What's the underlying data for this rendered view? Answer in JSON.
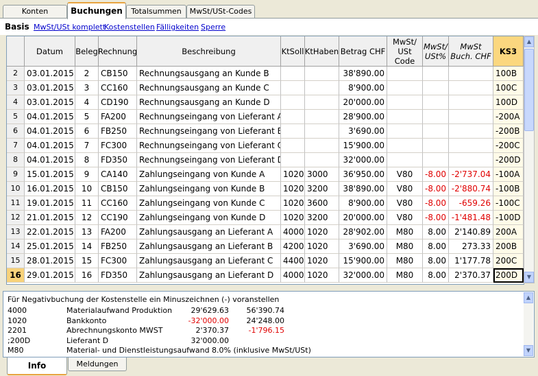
{
  "tabs": [
    "Konten",
    "Buchungen",
    "Totalsummen",
    "MwSt/USt-Codes"
  ],
  "views": [
    "Basis",
    "MwSt/USt komplett",
    "Kostenstellen",
    "Fälligkeiten",
    "Sperre"
  ],
  "columns": {
    "datum": "Datum",
    "beleg": "Beleg",
    "rechnung": "Rechnung",
    "beschreibung": "Beschreibung",
    "ktsoll": "KtSoll",
    "kthaben": "KtHaben",
    "betrag": "Betrag CHF",
    "mwst_code": "MwSt/ USt Code",
    "mwst_pct": "MwSt/ USt%",
    "mwst_buch": "MwSt Buch. CHF",
    "ks3": "KS3"
  },
  "rows": [
    {
      "n": "2",
      "datum": "03.01.2015",
      "beleg": "2",
      "rechnung": "CB150",
      "beschreibung": "Rechnungsausgang an Kunde B",
      "ktsoll": "",
      "kthaben": "",
      "betrag": "38'890.00",
      "code": "",
      "pct": "",
      "buch": "",
      "ks3": "100B"
    },
    {
      "n": "3",
      "datum": "03.01.2015",
      "beleg": "3",
      "rechnung": "CC160",
      "beschreibung": "Rechnungsausgang an Kunde C",
      "ktsoll": "",
      "kthaben": "",
      "betrag": "8'900.00",
      "code": "",
      "pct": "",
      "buch": "",
      "ks3": "100C"
    },
    {
      "n": "4",
      "datum": "03.01.2015",
      "beleg": "4",
      "rechnung": "CD190",
      "beschreibung": "Rechnungsausgang an Kunde D",
      "ktsoll": "",
      "kthaben": "",
      "betrag": "20'000.00",
      "code": "",
      "pct": "",
      "buch": "",
      "ks3": "100D"
    },
    {
      "n": "5",
      "datum": "04.01.2015",
      "beleg": "5",
      "rechnung": "FA200",
      "beschreibung": "Rechnungseingang von Lieferant A",
      "ktsoll": "",
      "kthaben": "",
      "betrag": "28'900.00",
      "code": "",
      "pct": "",
      "buch": "",
      "ks3": "-200A"
    },
    {
      "n": "6",
      "datum": "04.01.2015",
      "beleg": "6",
      "rechnung": "FB250",
      "beschreibung": "Rechnungseingang von Lieferant B",
      "ktsoll": "",
      "kthaben": "",
      "betrag": "3'690.00",
      "code": "",
      "pct": "",
      "buch": "",
      "ks3": "-200B"
    },
    {
      "n": "7",
      "datum": "04.01.2015",
      "beleg": "7",
      "rechnung": "FC300",
      "beschreibung": "Rechnungseingang von Lieferant C",
      "ktsoll": "",
      "kthaben": "",
      "betrag": "15'900.00",
      "code": "",
      "pct": "",
      "buch": "",
      "ks3": "-200C"
    },
    {
      "n": "8",
      "datum": "04.01.2015",
      "beleg": "8",
      "rechnung": "FD350",
      "beschreibung": "Rechnungseingang von Lieferant D",
      "ktsoll": "",
      "kthaben": "",
      "betrag": "32'000.00",
      "code": "",
      "pct": "",
      "buch": "",
      "ks3": "-200D"
    },
    {
      "n": "9",
      "datum": "15.01.2015",
      "beleg": "9",
      "rechnung": "CA140",
      "beschreibung": "Zahlungseingang von Kunde A",
      "ktsoll": "1020",
      "kthaben": "3000",
      "betrag": "36'950.00",
      "code": "V80",
      "pct": "-8.00",
      "buch": "-2'737.04",
      "ks3": "-100A"
    },
    {
      "n": "10",
      "datum": "16.01.2015",
      "beleg": "10",
      "rechnung": "CB150",
      "beschreibung": "Zahlungseingang von Kunde B",
      "ktsoll": "1020",
      "kthaben": "3200",
      "betrag": "38'890.00",
      "code": "V80",
      "pct": "-8.00",
      "buch": "-2'880.74",
      "ks3": "-100B"
    },
    {
      "n": "11",
      "datum": "19.01.2015",
      "beleg": "11",
      "rechnung": "CC160",
      "beschreibung": "Zahlungseingang von Kunde C",
      "ktsoll": "1020",
      "kthaben": "3600",
      "betrag": "8'900.00",
      "code": "V80",
      "pct": "-8.00",
      "buch": "-659.26",
      "ks3": "-100C"
    },
    {
      "n": "12",
      "datum": "21.01.2015",
      "beleg": "12",
      "rechnung": "CC190",
      "beschreibung": "Zahlungseingang von Kunde D",
      "ktsoll": "1020",
      "kthaben": "3200",
      "betrag": "20'000.00",
      "code": "V80",
      "pct": "-8.00",
      "buch": "-1'481.48",
      "ks3": "-100D"
    },
    {
      "n": "13",
      "datum": "22.01.2015",
      "beleg": "13",
      "rechnung": "FA200",
      "beschreibung": "Zahlungsausgang an Lieferant A",
      "ktsoll": "4000",
      "kthaben": "1020",
      "betrag": "28'902.00",
      "code": "M80",
      "pct": "8.00",
      "buch": "2'140.89",
      "ks3": "200A"
    },
    {
      "n": "14",
      "datum": "25.01.2015",
      "beleg": "14",
      "rechnung": "FB250",
      "beschreibung": "Zahlungsausgang an Lieferant B",
      "ktsoll": "4200",
      "kthaben": "1020",
      "betrag": "3'690.00",
      "code": "M80",
      "pct": "8.00",
      "buch": "273.33",
      "ks3": "200B"
    },
    {
      "n": "15",
      "datum": "28.01.2015",
      "beleg": "15",
      "rechnung": "FC300",
      "beschreibung": "Zahlungsausgang an Lieferant C",
      "ktsoll": "4400",
      "kthaben": "1020",
      "betrag": "15'900.00",
      "code": "M80",
      "pct": "8.00",
      "buch": "1'177.78",
      "ks3": "200C"
    },
    {
      "n": "16",
      "datum": "29.01.2015",
      "beleg": "16",
      "rechnung": "FD350",
      "beschreibung": "Zahlungsausgang an Lieferant D",
      "ktsoll": "4000",
      "kthaben": "1020",
      "betrag": "32'000.00",
      "code": "M80",
      "pct": "8.00",
      "buch": "2'370.37",
      "ks3": "200D"
    }
  ],
  "info": {
    "message": "Für Negativbuchung der Kostenstelle ein Minuszeichnen (-) voranstellen",
    "lines": [
      {
        "code": "4000",
        "name": "Materialaufwand Produktion",
        "amount": "29'629.63",
        "balance": "56'390.74"
      },
      {
        "code": "1020",
        "name": "Bankkonto",
        "amount": "-32'000.00",
        "balance": "24'248.00"
      },
      {
        "code": "2201",
        "name": "Abrechnungskonto MWST",
        "amount": "2'370.37",
        "balance": "-1'796.15"
      },
      {
        "code": ";200D",
        "name": "Lieferant D",
        "amount": "32'000.00",
        "balance": ""
      },
      {
        "code": "M80",
        "name": "Material- und Dienstleistungsaufwand 8.0% (inklusive MwSt/USt)",
        "amount": "",
        "balance": ""
      }
    ]
  },
  "bottom_tabs": [
    "Info",
    "Meldungen"
  ],
  "colors": {
    "accent": "#e8a33f",
    "negative": "#e00000",
    "link": "#0000cc",
    "ks3_header": "#fbd77f",
    "current_row": "#f8d27a"
  }
}
